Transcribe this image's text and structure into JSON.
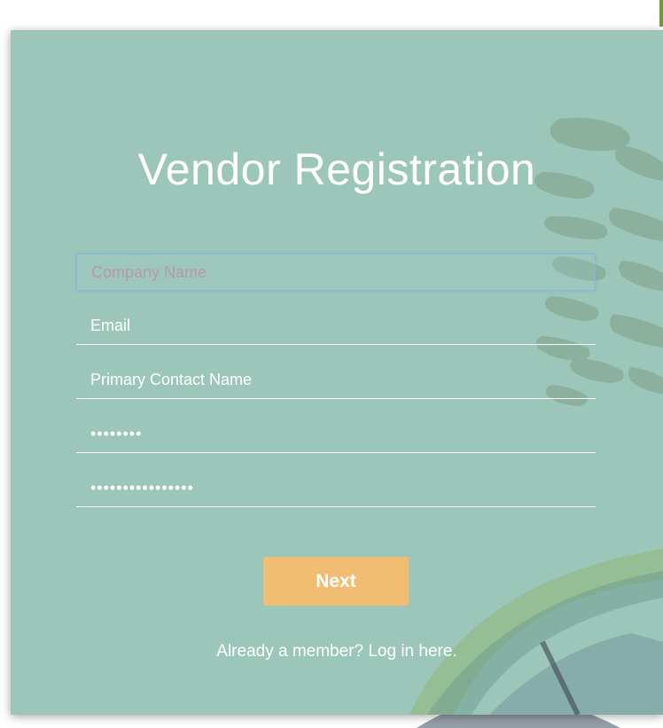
{
  "form": {
    "title": "Vendor Registration",
    "fields": [
      {
        "placeholder": "Company Name",
        "value": "",
        "type": "text"
      },
      {
        "placeholder": "Email",
        "value": "",
        "type": "text"
      },
      {
        "placeholder": "Primary Contact Name",
        "value": "",
        "type": "text"
      },
      {
        "placeholder": "",
        "value": "••••••••",
        "type": "password"
      },
      {
        "placeholder": "",
        "value": "••••••••••••••••",
        "type": "password"
      }
    ],
    "next_label": "Next",
    "login_text": "Already a member? Log in here."
  },
  "colors": {
    "card_background": "#9cc6ba",
    "button": "#f1bd72",
    "text": "#ffffff",
    "focus_border": "#86b8d6"
  }
}
